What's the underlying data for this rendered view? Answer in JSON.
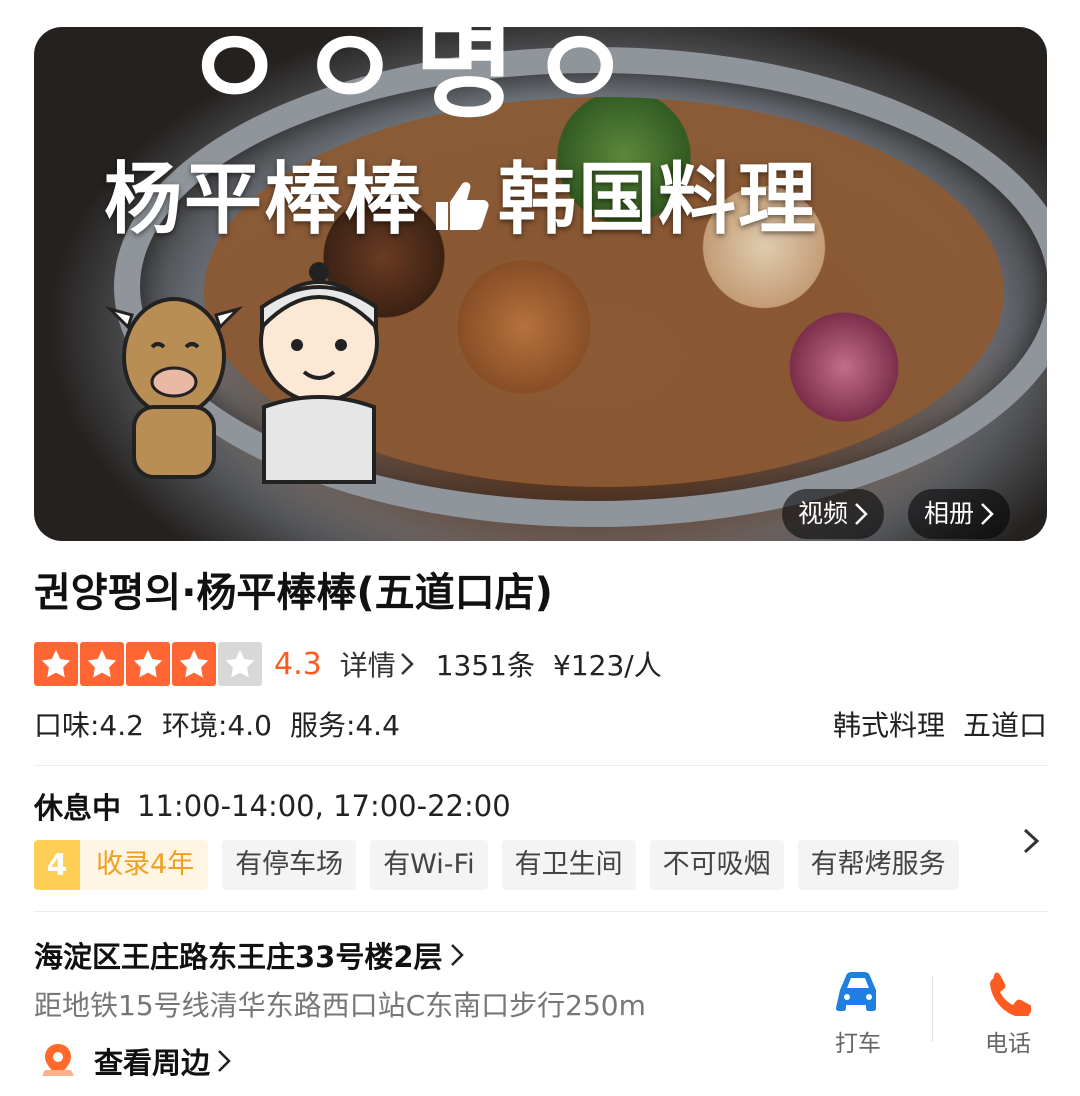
{
  "hero": {
    "top_letters": "ㅇㅇ명ㅇ",
    "title_left": "杨平棒棒",
    "title_right": "韩国料理",
    "video_label": "视频",
    "album_label": "相册"
  },
  "shop": {
    "name": "권양평의·杨平棒棒(五道口店)"
  },
  "rating": {
    "stars_filled": 4,
    "stars_total": 5,
    "score": "4.3",
    "detail_label": "详情",
    "review_count": "1351条",
    "price": "¥123/人"
  },
  "scores": {
    "taste": "口味:4.2",
    "environment": "环境:4.0",
    "service": "服务:4.4"
  },
  "categories": {
    "cuisine": "韩式料理",
    "area": "五道口"
  },
  "hours": {
    "status": "休息中",
    "time": "11:00-14:00, 17:00-22:00"
  },
  "tags": {
    "year_num": "4",
    "year_text": "收录4年",
    "items": [
      "有停车场",
      "有Wi-Fi",
      "有卫生间",
      "不可吸烟",
      "有帮烤服务"
    ]
  },
  "address": {
    "line": "海淀区王庄路东王庄33号楼2层",
    "metro": "距地铁15号线清华东路西口站C东南口步行250m",
    "nearby": "查看周边"
  },
  "actions": {
    "taxi": "打车",
    "phone": "电话"
  },
  "colors": {
    "accent": "#ff5a1f",
    "star_on": "#ff6633",
    "star_off": "#d8d8d8",
    "taxi_icon": "#1f7fe0",
    "phone_icon": "#ff5a1f",
    "year_badge": "#ffcf55"
  }
}
